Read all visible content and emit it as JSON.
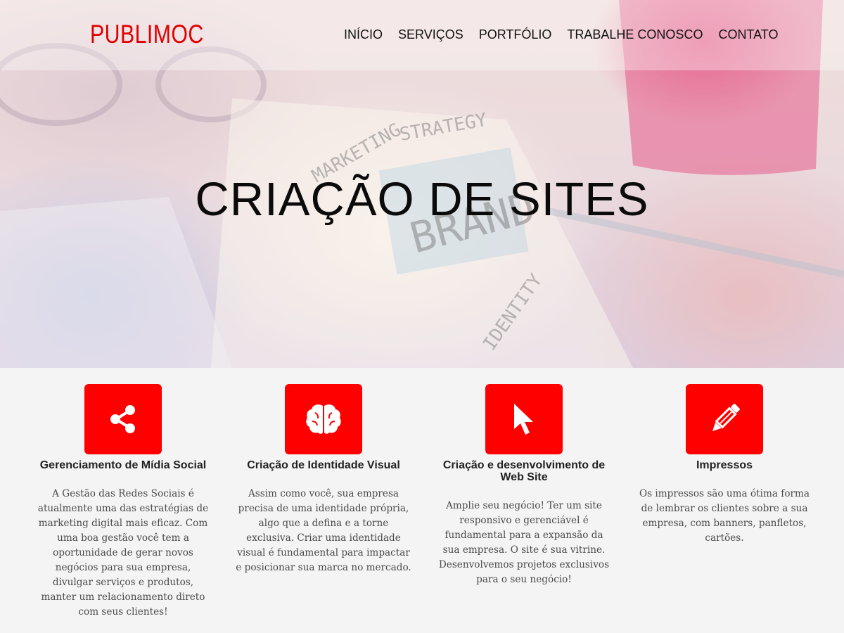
{
  "brand": {
    "logo": "PUBLIMOC"
  },
  "nav": {
    "items": [
      {
        "label": "INÍCIO"
      },
      {
        "label": "SERVIÇOS"
      },
      {
        "label": "PORTFÓLIO"
      },
      {
        "label": "TRABALHE CONOSCO"
      },
      {
        "label": "CONTATO"
      }
    ]
  },
  "hero": {
    "title": "CRIAÇÃO DE SITES",
    "background_words": [
      "MARKETING",
      "STRATEGY",
      "BRAND",
      "IDENTITY"
    ]
  },
  "services": [
    {
      "icon": "share-icon",
      "title": "Gerenciamento de Mídia Social",
      "text": "A Gestão das Redes Sociais é atualmente uma das estratégias de marketing digital mais eficaz. Com uma boa gestão você tem a oportunidade de gerar novos negócios para sua empresa, divulgar serviços e produtos, manter um relacionamento direto com seus clientes!"
    },
    {
      "icon": "brain-icon",
      "title": "Criação de Identidade Visual",
      "text": "Assim como você, sua empresa precisa de uma identidade própria, algo que a defina e a torne exclusiva. Criar uma identidade visual é fundamental para impactar e posicionar sua marca no mercado."
    },
    {
      "icon": "cursor-icon",
      "title": "Criação e desenvolvimento de Web Site",
      "text": "Amplie seu negócio! Ter um site responsivo e gerenciável é fundamental para a expansão da sua empresa. O site é sua vitrine. Desenvolvemos projetos exclusivos para o seu negócio!"
    },
    {
      "icon": "pencil-icon",
      "title": "Impressos",
      "text": "Os impressos são uma ótima forma de lembrar os clientes sobre a sua empresa, com banners, panfletos, cartões."
    }
  ],
  "colors": {
    "accent": "#ff0000",
    "logo": "#e00000"
  }
}
